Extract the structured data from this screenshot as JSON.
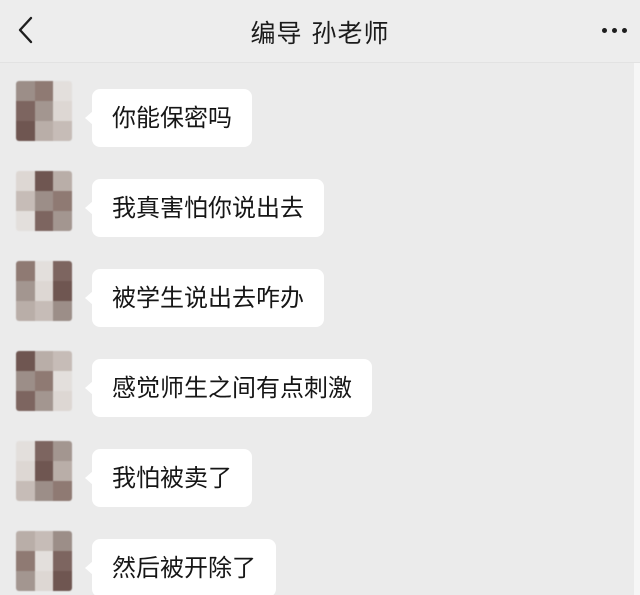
{
  "header": {
    "title": "编导 孙老师",
    "back_icon": "chevron-left-icon",
    "more_icon": "more-dots-icon"
  },
  "messages": [
    {
      "text": "你能保密吗"
    },
    {
      "text": "我真害怕你说出去"
    },
    {
      "text": "被学生说出去咋办"
    },
    {
      "text": "感觉师生之间有点刺激"
    },
    {
      "text": "我怕被卖了"
    },
    {
      "text": "然后被开除了"
    }
  ],
  "colors": {
    "background": "#ebebeb",
    "bubble": "#ffffff",
    "text": "#161616",
    "avatar_pixels": [
      "#9c8e88",
      "#b9aea8",
      "#ddd7d3",
      "#7d6560",
      "#8f7a73",
      "#c6bcb7",
      "#6f5651",
      "#a39690",
      "#e3dfdc"
    ]
  }
}
